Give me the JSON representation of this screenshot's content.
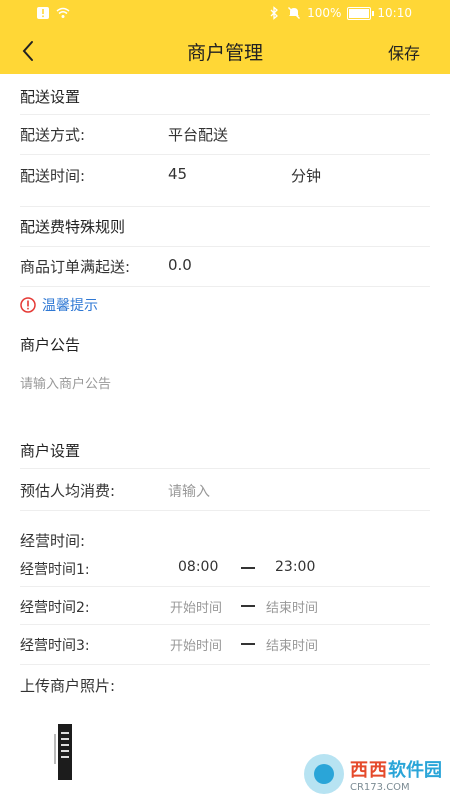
{
  "status_bar": {
    "battery": "100%",
    "time": "10:10"
  },
  "header": {
    "title": "商户管理",
    "save_label": "保存"
  },
  "delivery": {
    "section_title": "配送设置",
    "method_label": "配送方式:",
    "method_value": "平台配送",
    "time_label": "配送时间:",
    "time_value": "45",
    "time_unit": "分钟"
  },
  "fee_rules": {
    "section_title": "配送费特殊规则",
    "min_order_label": "商品订单满起送:",
    "min_order_value": "0.0",
    "tip_label": "温馨提示"
  },
  "notice": {
    "section_title": "商户公告",
    "placeholder": "请输入商户公告"
  },
  "merchant": {
    "section_title": "商户设置",
    "avg_label": "预估人均消费:",
    "avg_placeholder": "请输入",
    "hours_title": "经营时间:",
    "hours": [
      {
        "label": "经营时间1:",
        "start": "08:00",
        "end": "23:00"
      },
      {
        "label": "经营时间2:",
        "start": "开始时间",
        "end": "结束时间"
      },
      {
        "label": "经营时间3:",
        "start": "开始时间",
        "end": "结束时间"
      }
    ],
    "photo_label": "上传商户照片:"
  },
  "watermark": {
    "brand": "西西",
    "text": "软件园",
    "sub": "CR173.COM"
  },
  "colors": {
    "header_bg": "#ffd736",
    "tip_blue": "#2f78d4",
    "tip_red": "#e53935"
  }
}
